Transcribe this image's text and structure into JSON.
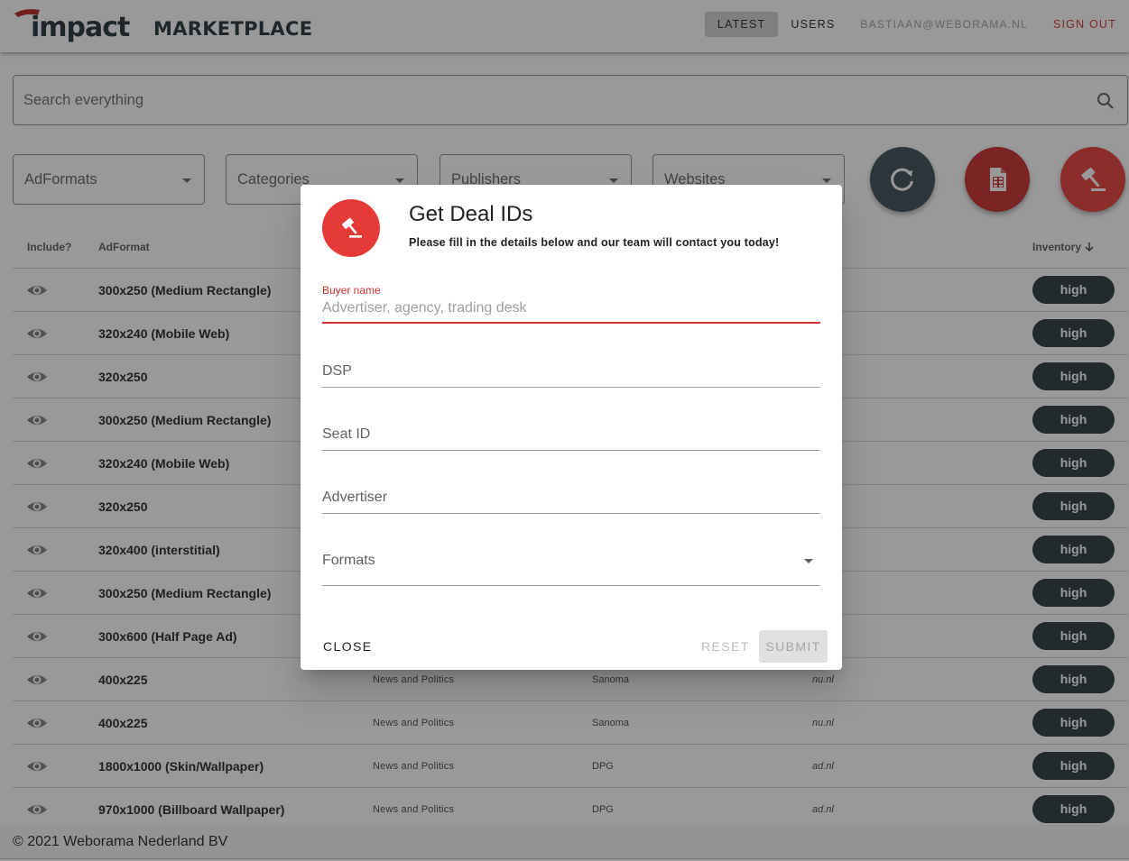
{
  "brand": {
    "word": "impact",
    "market": "MARKETPLACE"
  },
  "nav": {
    "latest": "LATEST",
    "users": "USERS",
    "email": "BASTIAAN@WEBORAMA.NL",
    "signout": "SIGN OUT"
  },
  "search": {
    "placeholder": "Search everything"
  },
  "filters": [
    "AdFormats",
    "Categories",
    "Publishers",
    "Websites"
  ],
  "table": {
    "headers": {
      "include": "Include?",
      "adformat": "AdFormat",
      "inventory": "Inventory"
    },
    "rows": [
      {
        "format": "300x250 (Medium Rectangle)",
        "category": "",
        "publisher": "",
        "website": "",
        "inventory": "high"
      },
      {
        "format": "320x240 (Mobile Web)",
        "category": "",
        "publisher": "",
        "website": "",
        "inventory": "high"
      },
      {
        "format": "320x250",
        "category": "",
        "publisher": "",
        "website": "",
        "inventory": "high"
      },
      {
        "format": "300x250 (Medium Rectangle)",
        "category": "",
        "publisher": "",
        "website": "",
        "inventory": "high"
      },
      {
        "format": "320x240 (Mobile Web)",
        "category": "",
        "publisher": "",
        "website": "",
        "inventory": "high"
      },
      {
        "format": "320x250",
        "category": "",
        "publisher": "",
        "website": "",
        "inventory": "high"
      },
      {
        "format": "320x400 (interstitial)",
        "category": "",
        "publisher": "",
        "website": "",
        "inventory": "high"
      },
      {
        "format": "300x250 (Medium Rectangle)",
        "category": "",
        "publisher": "",
        "website": "",
        "inventory": "high"
      },
      {
        "format": "300x600 (Half Page Ad)",
        "category": "",
        "publisher": "",
        "website": "",
        "inventory": "high"
      },
      {
        "format": "400x225",
        "category": "News and Politics",
        "publisher": "Sanoma",
        "website": "nu.nl",
        "inventory": "high"
      },
      {
        "format": "400x225",
        "category": "News and Politics",
        "publisher": "Sanoma",
        "website": "nu.nl",
        "inventory": "high"
      },
      {
        "format": "1800x1000 (Skin/Wallpaper)",
        "category": "News and Politics",
        "publisher": "DPG",
        "website": "ad.nl",
        "inventory": "high"
      },
      {
        "format": "970x1000 (Billboard Wallpaper)",
        "category": "News and Politics",
        "publisher": "DPG",
        "website": "ad.nl",
        "inventory": "high"
      }
    ]
  },
  "footer": {
    "text": "© 2021 Weborama Nederland BV"
  },
  "dialog": {
    "title": "Get Deal IDs",
    "subtitle": "Please fill in the details below and our team will contact you today!",
    "buyer": {
      "label": "Buyer name",
      "placeholder": "Advertiser, agency, trading desk"
    },
    "dsp": "DSP",
    "seat": "Seat ID",
    "advertiser": "Advertiser",
    "formats": "Formats",
    "close": "CLOSE",
    "reset": "RESET",
    "submit": "SUBMIT"
  },
  "colors": {
    "accent_red": "#e53935",
    "dark_chip": "#263238",
    "fab_dark": "#37474f",
    "fab_red_dark": "#c62828"
  }
}
